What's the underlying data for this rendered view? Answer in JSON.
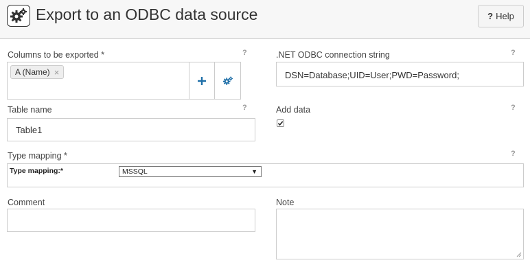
{
  "header": {
    "title": "Export to an ODBC data source",
    "help_label": "Help",
    "help_glyph": "?"
  },
  "columns": {
    "label": "Columns to be exported *",
    "chips": [
      "A (Name)"
    ],
    "help_glyph": "?"
  },
  "connection": {
    "label": ".NET ODBC connection string",
    "value": "DSN=Database;UID=User;PWD=Password;",
    "help_glyph": "?"
  },
  "table_name": {
    "label": "Table name",
    "value": "Table1",
    "help_glyph": "?"
  },
  "add_data": {
    "label": "Add data",
    "checked": true,
    "help_glyph": "?"
  },
  "type_mapping": {
    "label": "Type mapping *",
    "inner_label": "Type mapping:*",
    "selected": "MSSQL",
    "help_glyph": "?"
  },
  "comment": {
    "label": "Comment",
    "value": ""
  },
  "note": {
    "label": "Note",
    "value": ""
  },
  "colors": {
    "accent": "#1f6fa8",
    "border": "#cccccc",
    "header_bg": "#f7f7f7"
  },
  "icons": {
    "logo": "gears-icon",
    "add": "plus-icon",
    "settings": "gears-icon",
    "remove": "close-icon",
    "dropdown": "caret-down-icon",
    "check": "check-icon"
  }
}
